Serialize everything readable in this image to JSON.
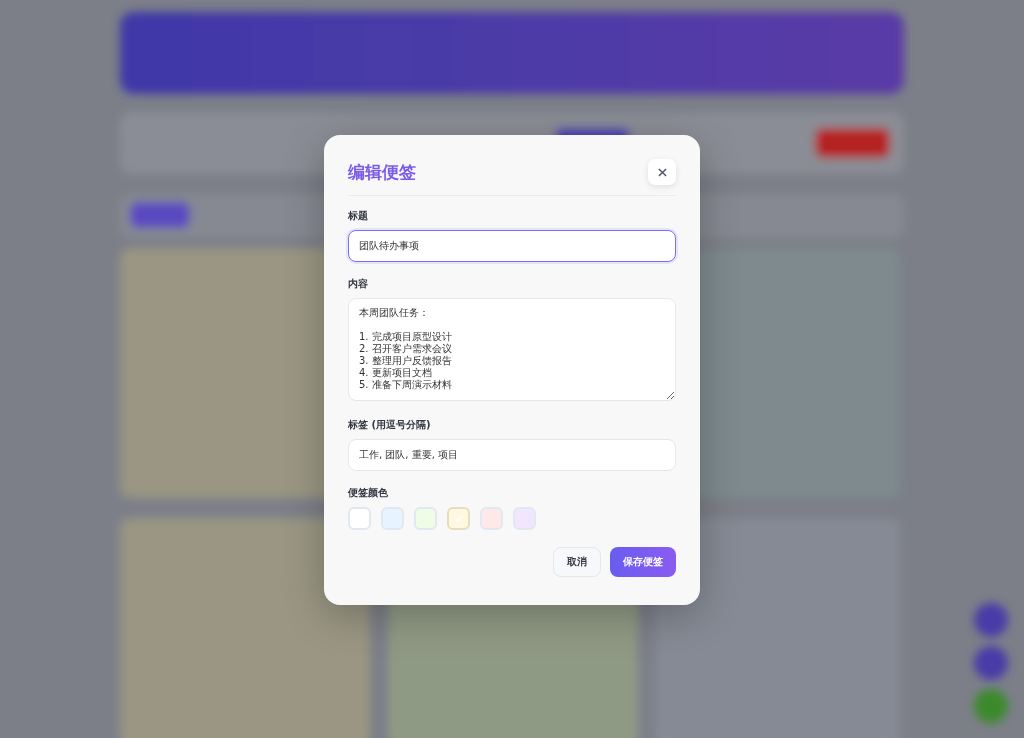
{
  "dialog": {
    "title": "编辑便签",
    "fields": [
      {
        "kind": "input",
        "label": "标题",
        "value": "团队待办事项",
        "focused": true
      },
      {
        "kind": "textarea",
        "label": "内容",
        "value": "本周团队任务：\n\n1. 完成项目原型设计\n2. 召开客户需求会议\n3. 整理用户反馈报告\n4. 更新项目文档\n5. 准备下周演示材料",
        "focused": false
      },
      {
        "kind": "input",
        "label": "标签 (用逗号分隔)",
        "value": "工作, 团队, 重要, 项目",
        "focused": false
      }
    ],
    "color_label": "便签颜色",
    "colors": [
      {
        "color": "#ffffff",
        "selected": false
      },
      {
        "color": "#e6f4ff",
        "selected": false
      },
      {
        "color": "#effde6",
        "selected": false
      },
      {
        "color": "#fff8e1",
        "selected": true
      },
      {
        "color": "#ffe8e8",
        "selected": false
      },
      {
        "color": "#f2e6ff",
        "selected": false
      }
    ],
    "buttons": [
      {
        "kind": "secondary",
        "label": "取消"
      },
      {
        "kind": "primary",
        "label": "保存便签"
      }
    ]
  }
}
